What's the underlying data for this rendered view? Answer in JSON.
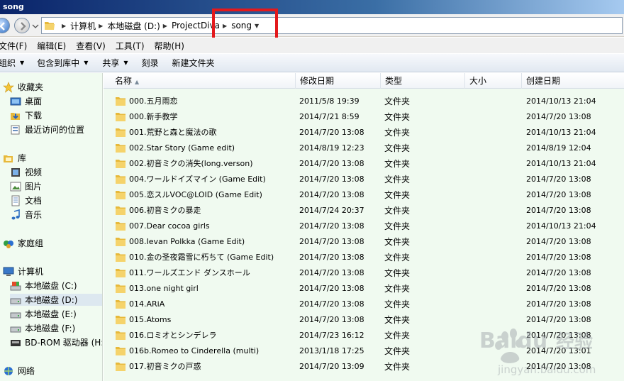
{
  "window": {
    "title": "song"
  },
  "address": {
    "crumbs": [
      "计算机",
      "本地磁盘 (D:)",
      "ProjectDiva",
      "song"
    ]
  },
  "menu": [
    "文件(F)",
    "编辑(E)",
    "查看(V)",
    "工具(T)",
    "帮助(H)"
  ],
  "toolbar": {
    "organize": "组织",
    "include_library": "包含到库中",
    "share": "共享",
    "burn": "刻录",
    "new_folder": "新建文件夹"
  },
  "sidebar": {
    "favorites": "收藏夹",
    "fav_items": [
      "桌面",
      "下载",
      "最近访问的位置"
    ],
    "library": "库",
    "lib_items": [
      "视频",
      "图片",
      "文档",
      "音乐"
    ],
    "homegroup": "家庭组",
    "computer": "计算机",
    "drives": [
      "本地磁盘 (C:)",
      "本地磁盘 (D:)",
      "本地磁盘 (E:)",
      "本地磁盘 (F:)",
      "BD-ROM 驱动器 (H:)"
    ],
    "network": "网络"
  },
  "columns": {
    "name": "名称",
    "modified": "修改日期",
    "type": "类型",
    "size": "大小",
    "created": "创建日期"
  },
  "files": [
    {
      "name": "000.五月雨恋",
      "modified": "2011/5/8 19:39",
      "type": "文件夹",
      "created": "2014/10/13 21:04"
    },
    {
      "name": "000.新手教学",
      "modified": "2014/7/21 8:59",
      "type": "文件夹",
      "created": "2014/7/20 13:08"
    },
    {
      "name": "001.荒野と森と魔法の歌",
      "modified": "2014/7/20 13:08",
      "type": "文件夹",
      "created": "2014/10/13 21:04"
    },
    {
      "name": "002.Star Story (Game edit)",
      "modified": "2014/8/19 12:23",
      "type": "文件夹",
      "created": "2014/8/19 12:04"
    },
    {
      "name": "002.初音ミクの消失(long.verson)",
      "modified": "2014/7/20 13:08",
      "type": "文件夹",
      "created": "2014/10/13 21:04"
    },
    {
      "name": "004.ワールドイズマイン (Game Edit)",
      "modified": "2014/7/20 13:08",
      "type": "文件夹",
      "created": "2014/7/20 13:08"
    },
    {
      "name": "005.恋スルVOC@LOID (Game Edit)",
      "modified": "2014/7/20 13:08",
      "type": "文件夹",
      "created": "2014/7/20 13:08"
    },
    {
      "name": "006.初音ミクの暴走",
      "modified": "2014/7/24 20:37",
      "type": "文件夹",
      "created": "2014/7/20 13:08"
    },
    {
      "name": "007.Dear cocoa girls",
      "modified": "2014/7/20 13:08",
      "type": "文件夹",
      "created": "2014/10/13 21:04"
    },
    {
      "name": "008.Ievan Polkka (Game Edit)",
      "modified": "2014/7/20 13:08",
      "type": "文件夹",
      "created": "2014/7/20 13:08"
    },
    {
      "name": "010.金の圣夜霜雪に朽ちて (Game Edit)",
      "modified": "2014/7/20 13:08",
      "type": "文件夹",
      "created": "2014/7/20 13:08"
    },
    {
      "name": "011.ワールズエンド ダンスホール",
      "modified": "2014/7/20 13:08",
      "type": "文件夹",
      "created": "2014/7/20 13:08"
    },
    {
      "name": "013.one night girl",
      "modified": "2014/7/20 13:08",
      "type": "文件夹",
      "created": "2014/7/20 13:08"
    },
    {
      "name": "014.ARiA",
      "modified": "2014/7/20 13:08",
      "type": "文件夹",
      "created": "2014/7/20 13:08"
    },
    {
      "name": "015.Atoms",
      "modified": "2014/7/20 13:08",
      "type": "文件夹",
      "created": "2014/7/20 13:08"
    },
    {
      "name": "016.ロミオとシンデレラ",
      "modified": "2014/7/23 16:12",
      "type": "文件夹",
      "created": "2014/7/20 13:08"
    },
    {
      "name": "016b.Romeo to Cinderella (multi)",
      "modified": "2013/1/18 17:25",
      "type": "文件夹",
      "created": "2014/7/20 13:01"
    },
    {
      "name": "017.初音ミクの戸惑",
      "modified": "2014/7/20 13:09",
      "type": "文件夹",
      "created": "2014/7/20 13:08"
    }
  ],
  "watermark": {
    "brand": "Baidu",
    "brand_cn": "经验",
    "url": "jingyan.baidu.com"
  },
  "colors": {
    "highlight_box": "#e3191c",
    "file_bg": "#f0faf0",
    "folder_yellow": "#f0c24a"
  }
}
